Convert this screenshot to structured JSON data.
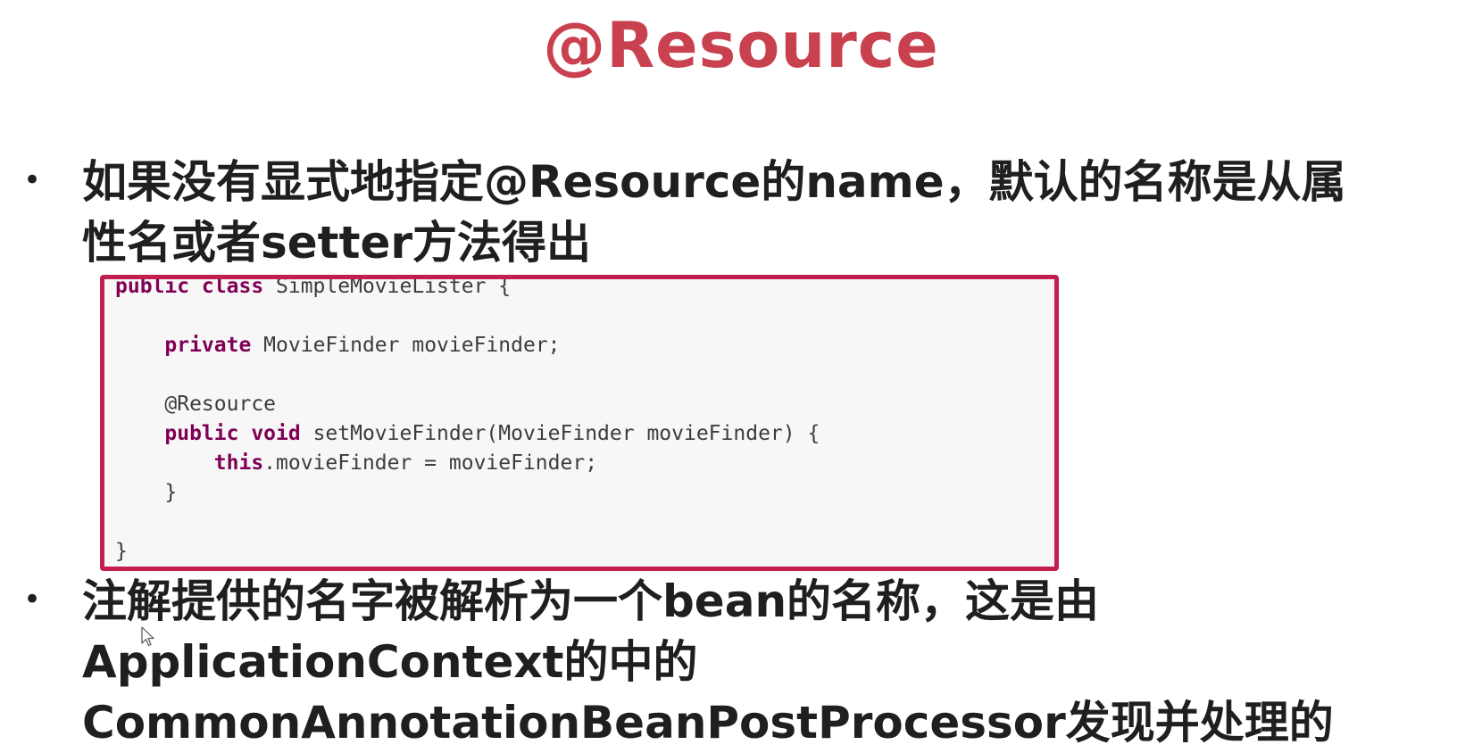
{
  "slide": {
    "title": "@Resource",
    "bullet1": {
      "marker": "•",
      "line1": "如果没有显式地指定@Resource的name，默认的名称是从属",
      "line2": "性名或者setter方法得出"
    },
    "bullet2": {
      "marker": "•",
      "line1": "注解提供的名字被解析为一个bean的名称，这是由",
      "line2": "ApplicationContext的中的",
      "line3": "CommonAnnotationBeanPostProcessor发现并处理的"
    }
  },
  "code": {
    "lines": [
      {
        "indent": "",
        "kw": "public class",
        "rest": " SimpleMovieLister {"
      },
      {
        "indent": "",
        "kw": "",
        "rest": ""
      },
      {
        "indent": "    ",
        "kw": "private",
        "rest": " MovieFinder movieFinder;"
      },
      {
        "indent": "",
        "kw": "",
        "rest": ""
      },
      {
        "indent": "    ",
        "kw": "",
        "rest": "@Resource"
      },
      {
        "indent": "    ",
        "kw": "public void",
        "rest": " setMovieFinder(MovieFinder movieFinder) {"
      },
      {
        "indent": "        ",
        "kw": "this",
        "rest": ".movieFinder = movieFinder;"
      },
      {
        "indent": "    ",
        "kw": "",
        "rest": "}"
      },
      {
        "indent": "",
        "kw": "",
        "rest": ""
      },
      {
        "indent": "",
        "kw": "",
        "rest": "}"
      }
    ]
  },
  "icons": {
    "cursor": "mouse-pointer-icon"
  },
  "colors": {
    "title": "#c9414f",
    "code_border": "#c21f4e",
    "keyword": "#7f0055"
  }
}
